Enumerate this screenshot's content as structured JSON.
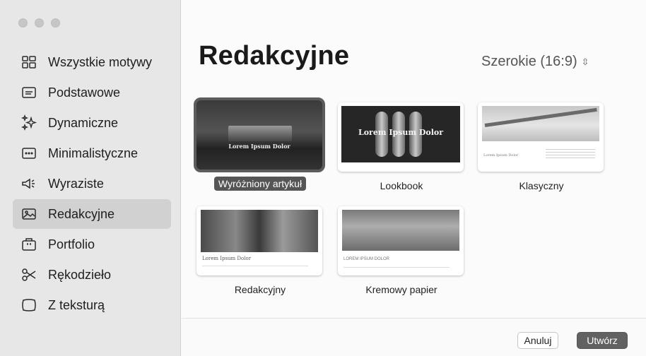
{
  "window": {
    "traffic_lights": [
      "close",
      "minimize",
      "zoom"
    ]
  },
  "sidebar": {
    "items": [
      {
        "label": "Wszystkie motywy",
        "icon": "grid-icon"
      },
      {
        "label": "Podstawowe",
        "icon": "text-box-icon"
      },
      {
        "label": "Dynamiczne",
        "icon": "sparkles-icon"
      },
      {
        "label": "Minimalistyczne",
        "icon": "dots-box-icon"
      },
      {
        "label": "Wyraziste",
        "icon": "megaphone-icon"
      },
      {
        "label": "Redakcyjne",
        "icon": "photo-icon",
        "active": true
      },
      {
        "label": "Portfolio",
        "icon": "briefcase-icon"
      },
      {
        "label": "Rękodzieło",
        "icon": "scissors-icon"
      },
      {
        "label": "Z teksturą",
        "icon": "frame-icon"
      }
    ]
  },
  "main": {
    "title": "Redakcyjne",
    "aspect": {
      "value": "Szerokie (16:9)",
      "icon": "chevron-updown-icon"
    },
    "themes": [
      {
        "label": "Wyróżniony artykuł",
        "thumb_text": "Lorem Ipsum Dolor",
        "selected": true
      },
      {
        "label": "Lookbook",
        "thumb_text": "Lorem Ipsum Dolor"
      },
      {
        "label": "Klasyczny",
        "thumb_text": "Lorem Ipsum Dolor"
      },
      {
        "label": "Redakcyjny",
        "thumb_text": "Lorem Ipsum Dolor"
      },
      {
        "label": "Kremowy papier",
        "thumb_text": "LOREM IPSUM DOLOR"
      }
    ]
  },
  "footer": {
    "cancel_label": "Anuluj",
    "create_label": "Utwórz"
  },
  "colors": {
    "sidebar_bg": "#e7e7e7",
    "active_item_bg": "#d1d1d1",
    "primary_button": "#626262",
    "selection_outline": "#5c5c5c"
  }
}
